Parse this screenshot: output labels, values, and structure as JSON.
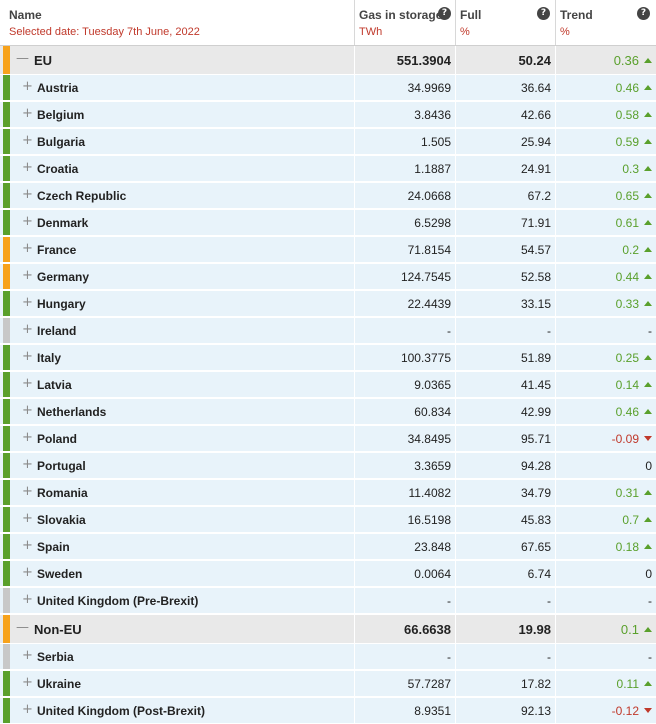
{
  "header": {
    "name_title": "Name",
    "selected_date": "Selected date: Tuesday 7th June, 2022",
    "storage_title": "Gas in storage",
    "storage_unit": "TWh",
    "full_title": "Full",
    "full_unit": "%",
    "trend_title": "Trend",
    "trend_unit": "%",
    "help_glyph": "?"
  },
  "colors": {
    "green": "#5aa02c",
    "orange": "#f7a21b",
    "gray": "#c8c8c8",
    "red": "#c0392b",
    "text": "#222222"
  },
  "rows": [
    {
      "type": "group",
      "name": "EU",
      "storage": "551.3904",
      "full": "50.24",
      "trend": "0.36",
      "dir": "up",
      "bar": "orange"
    },
    {
      "type": "child",
      "name": "Austria",
      "storage": "34.9969",
      "full": "36.64",
      "trend": "0.46",
      "dir": "up",
      "bar": "green"
    },
    {
      "type": "child",
      "name": "Belgium",
      "storage": "3.8436",
      "full": "42.66",
      "trend": "0.58",
      "dir": "up",
      "bar": "green"
    },
    {
      "type": "child",
      "name": "Bulgaria",
      "storage": "1.505",
      "full": "25.94",
      "trend": "0.59",
      "dir": "up",
      "bar": "green"
    },
    {
      "type": "child",
      "name": "Croatia",
      "storage": "1.1887",
      "full": "24.91",
      "trend": "0.3",
      "dir": "up",
      "bar": "green"
    },
    {
      "type": "child",
      "name": "Czech Republic",
      "storage": "24.0668",
      "full": "67.2",
      "trend": "0.65",
      "dir": "up",
      "bar": "green"
    },
    {
      "type": "child",
      "name": "Denmark",
      "storage": "6.5298",
      "full": "71.91",
      "trend": "0.61",
      "dir": "up",
      "bar": "green"
    },
    {
      "type": "child",
      "name": "France",
      "storage": "71.8154",
      "full": "54.57",
      "trend": "0.2",
      "dir": "up",
      "bar": "orange"
    },
    {
      "type": "child",
      "name": "Germany",
      "storage": "124.7545",
      "full": "52.58",
      "trend": "0.44",
      "dir": "up",
      "bar": "orange"
    },
    {
      "type": "child",
      "name": "Hungary",
      "storage": "22.4439",
      "full": "33.15",
      "trend": "0.33",
      "dir": "up",
      "bar": "green"
    },
    {
      "type": "child",
      "name": "Ireland",
      "storage": "-",
      "full": "-",
      "trend": "-",
      "dir": "none",
      "bar": "gray"
    },
    {
      "type": "child",
      "name": "Italy",
      "storage": "100.3775",
      "full": "51.89",
      "trend": "0.25",
      "dir": "up",
      "bar": "green"
    },
    {
      "type": "child",
      "name": "Latvia",
      "storage": "9.0365",
      "full": "41.45",
      "trend": "0.14",
      "dir": "up",
      "bar": "green"
    },
    {
      "type": "child",
      "name": "Netherlands",
      "storage": "60.834",
      "full": "42.99",
      "trend": "0.46",
      "dir": "up",
      "bar": "green"
    },
    {
      "type": "child",
      "name": "Poland",
      "storage": "34.8495",
      "full": "95.71",
      "trend": "-0.09",
      "dir": "down",
      "bar": "green"
    },
    {
      "type": "child",
      "name": "Portugal",
      "storage": "3.3659",
      "full": "94.28",
      "trend": "0",
      "dir": "none",
      "bar": "green"
    },
    {
      "type": "child",
      "name": "Romania",
      "storage": "11.4082",
      "full": "34.79",
      "trend": "0.31",
      "dir": "up",
      "bar": "green"
    },
    {
      "type": "child",
      "name": "Slovakia",
      "storage": "16.5198",
      "full": "45.83",
      "trend": "0.7",
      "dir": "up",
      "bar": "green"
    },
    {
      "type": "child",
      "name": "Spain",
      "storage": "23.848",
      "full": "67.65",
      "trend": "0.18",
      "dir": "up",
      "bar": "green"
    },
    {
      "type": "child",
      "name": "Sweden",
      "storage": "0.0064",
      "full": "6.74",
      "trend": "0",
      "dir": "none",
      "bar": "green"
    },
    {
      "type": "child",
      "name": "United Kingdom (Pre-Brexit)",
      "storage": "-",
      "full": "-",
      "trend": "-",
      "dir": "none",
      "bar": "gray"
    },
    {
      "type": "group",
      "name": "Non-EU",
      "storage": "66.6638",
      "full": "19.98",
      "trend": "0.1",
      "dir": "up",
      "bar": "orange"
    },
    {
      "type": "child",
      "name": "Serbia",
      "storage": "-",
      "full": "-",
      "trend": "-",
      "dir": "none",
      "bar": "gray"
    },
    {
      "type": "child",
      "name": "Ukraine",
      "storage": "57.7287",
      "full": "17.82",
      "trend": "0.11",
      "dir": "up",
      "bar": "green"
    },
    {
      "type": "child",
      "name": "United Kingdom (Post-Brexit)",
      "storage": "8.9351",
      "full": "92.13",
      "trend": "-0.12",
      "dir": "down",
      "bar": "green"
    }
  ]
}
